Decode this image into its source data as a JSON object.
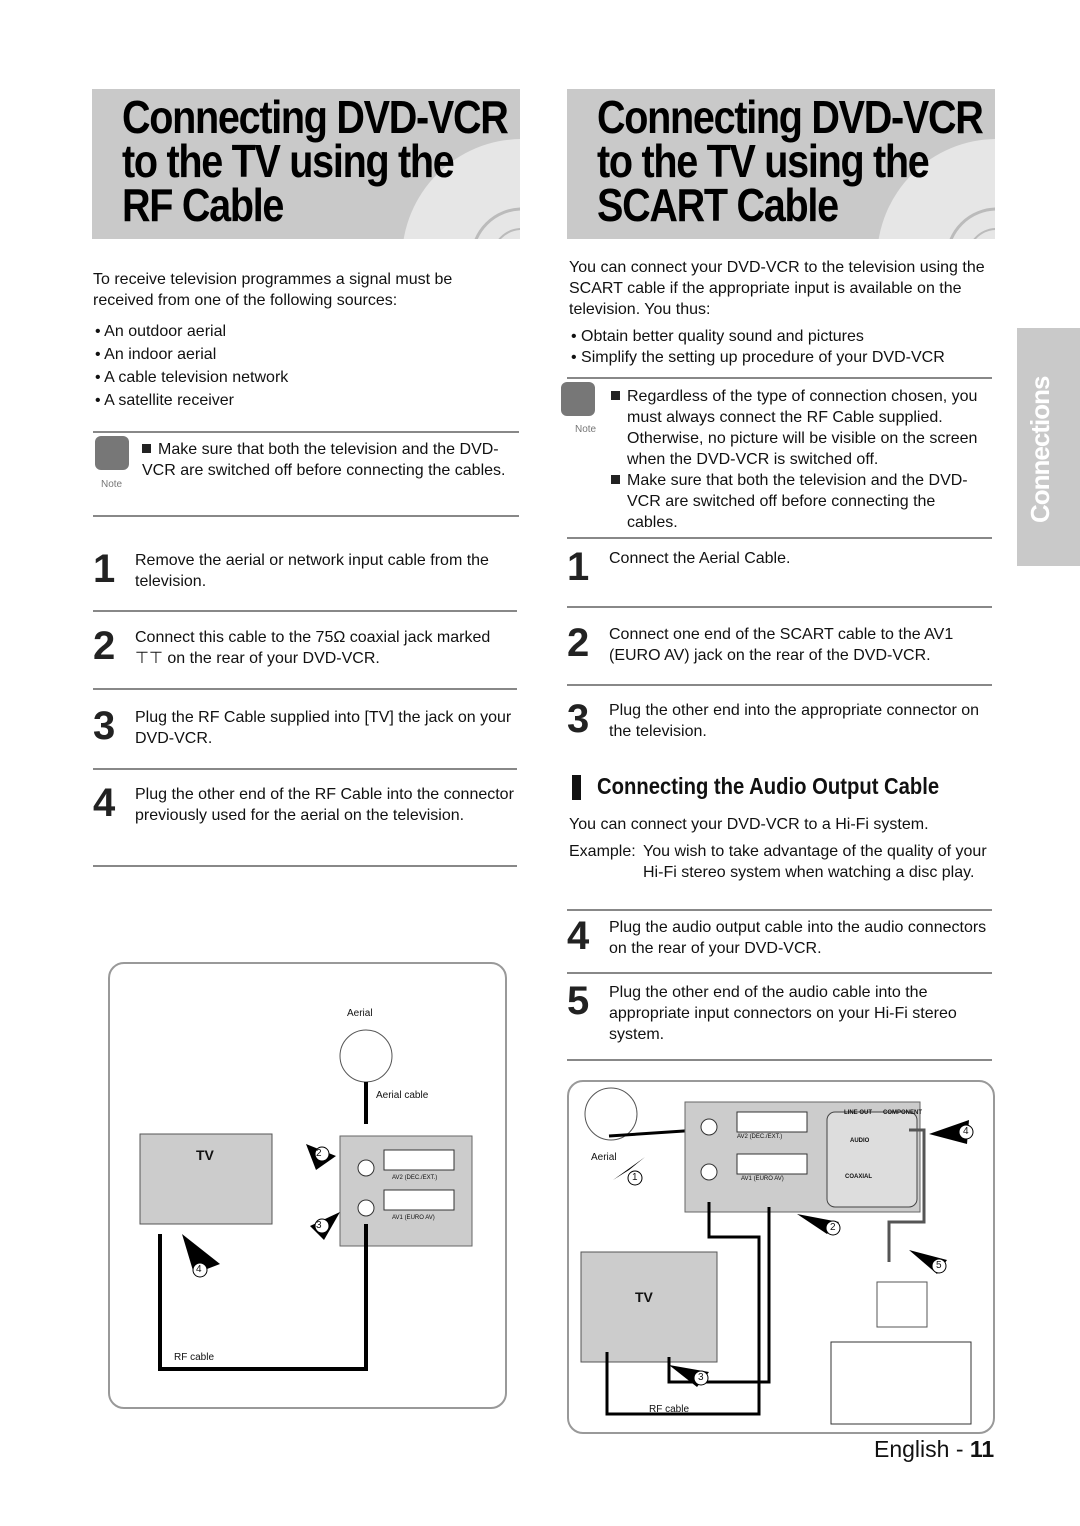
{
  "left": {
    "title": [
      "Connecting DVD-VCR",
      "to the TV using the",
      "RF Cable"
    ],
    "intro": "To receive television programmes a signal must be received from one of the following sources:",
    "bullets": [
      "An outdoor aerial",
      "An indoor aerial",
      "A cable television network",
      "A satellite receiver"
    ],
    "note_label": "Note",
    "note": "Make sure that both the television and the DVD-VCR are switched off before connecting the cables.",
    "steps": [
      {
        "num": "1",
        "text": "Remove the aerial or network input cable from the television."
      },
      {
        "num": "2",
        "text": "Connect this cable to the 75Ω coaxial jack marked ⊤⊤ on the rear of your DVD-VCR."
      },
      {
        "num": "3",
        "text": "Plug the RF Cable supplied into [TV] the jack on your DVD-VCR."
      },
      {
        "num": "4",
        "text": "Plug the other end of the RF Cable into the connector previously used for the aerial on the television."
      }
    ],
    "diagram": {
      "aerial": "Aerial",
      "aerial_cable": "Aerial cable",
      "tv": "TV",
      "rf_cable": "RF cable",
      "av2": "AV2 (DEC./EXT.)",
      "av1": "AV1 (EURO AV)",
      "markers": [
        "2",
        "3",
        "4"
      ]
    }
  },
  "right": {
    "title": [
      "Connecting DVD-VCR",
      "to the TV using the",
      "SCART Cable"
    ],
    "intro": "You can connect your DVD-VCR to the television using the SCART cable if the appropriate input is available on the television. You thus:",
    "bullets": [
      "Obtain better quality sound and pictures",
      "Simplify the setting up procedure of your DVD-VCR"
    ],
    "note_label": "Note",
    "notes": [
      "Regardless of the type of connection chosen, you must always connect the RF Cable supplied. Otherwise, no picture will be visible on the screen when the DVD-VCR is switched off.",
      "Make sure that both the television and the DVD-VCR are switched off before connecting the cables."
    ],
    "steps": [
      {
        "num": "1",
        "text": "Connect the Aerial Cable."
      },
      {
        "num": "2",
        "text": "Connect one end of the SCART cable to the AV1 (EURO AV) jack on the rear of the DVD-VCR."
      },
      {
        "num": "3",
        "text": "Plug the other end into the appropriate connector on the television."
      }
    ],
    "audio_heading": "Connecting the Audio Output Cable",
    "audio_intro": "You can connect your DVD-VCR to a Hi-Fi system.",
    "example_label": "Example:",
    "example_text": "You wish to take advantage of the quality of your Hi-Fi stereo system when watching a disc play.",
    "audio_steps": [
      {
        "num": "4",
        "text": "Plug the audio output cable into the audio connectors on the rear of your DVD-VCR."
      },
      {
        "num": "5",
        "text": "Plug the other end of the audio cable into the appropriate input connectors on your Hi-Fi stereo system."
      }
    ],
    "diagram": {
      "aerial": "Aerial",
      "tv": "TV",
      "rf_cable": "RF cable",
      "line_out": "LINE OUT",
      "audio": "AUDIO",
      "component": "COMPONENT",
      "coaxial": "COAXIAL",
      "av2": "AV2 (DEC./EXT.)",
      "av1": "AV1 (EURO AV)",
      "markers": [
        "1",
        "2",
        "3",
        "4",
        "5"
      ]
    }
  },
  "side_tab": "Connections",
  "footer": {
    "language": "English - ",
    "page": "11"
  },
  "colors": {
    "banner": "#c9c9c9",
    "tab": "#c9c9c9",
    "rule": "#888888"
  }
}
